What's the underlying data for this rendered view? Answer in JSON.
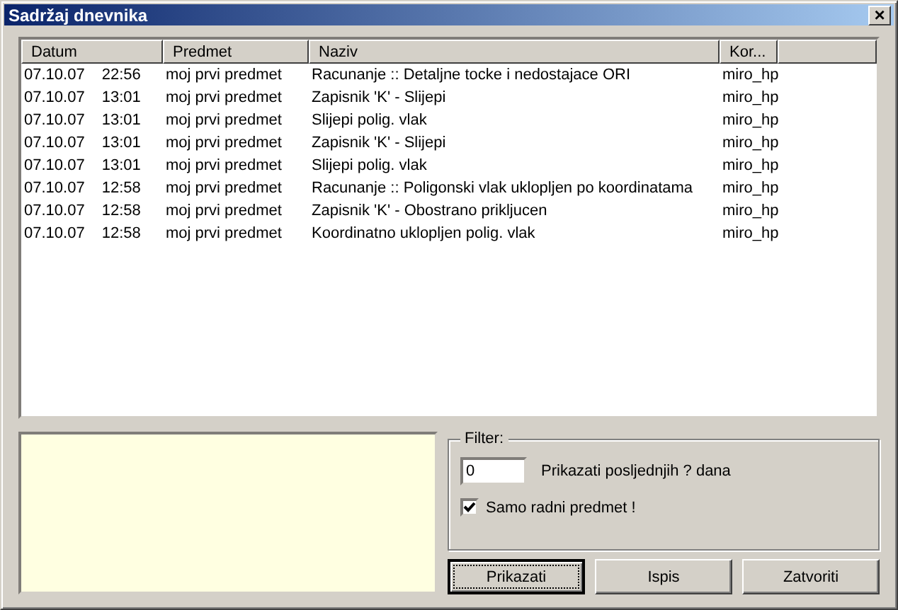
{
  "window": {
    "title": "Sadržaj dnevnika",
    "close": "×"
  },
  "table": {
    "columns": [
      "Datum",
      "Predmet",
      "Naziv",
      "Kor..."
    ],
    "rows": [
      {
        "date": "07.10.07",
        "time": "22:56",
        "predmet": "moj prvi predmet",
        "naziv": "Racunanje :: Detaljne tocke i nedostajace ORI",
        "korisnik": "miro_hp"
      },
      {
        "date": "07.10.07",
        "time": "13:01",
        "predmet": "moj prvi predmet",
        "naziv": "Zapisnik 'K' - Slijepi",
        "korisnik": "miro_hp"
      },
      {
        "date": "07.10.07",
        "time": "13:01",
        "predmet": "moj prvi predmet",
        "naziv": "Slijepi polig. vlak",
        "korisnik": "miro_hp"
      },
      {
        "date": "07.10.07",
        "time": "13:01",
        "predmet": "moj prvi predmet",
        "naziv": "Zapisnik 'K' - Slijepi",
        "korisnik": "miro_hp"
      },
      {
        "date": "07.10.07",
        "time": "13:01",
        "predmet": "moj prvi predmet",
        "naziv": "Slijepi polig. vlak",
        "korisnik": "miro_hp"
      },
      {
        "date": "07.10.07",
        "time": "12:58",
        "predmet": "moj prvi predmet",
        "naziv": "Racunanje :: Poligonski vlak uklopljen po koordinatama",
        "korisnik": "miro_hp"
      },
      {
        "date": "07.10.07",
        "time": "12:58",
        "predmet": "moj prvi predmet",
        "naziv": "Zapisnik 'K' - Obostrano prikljucen",
        "korisnik": "miro_hp"
      },
      {
        "date": "07.10.07",
        "time": "12:58",
        "predmet": "moj prvi predmet",
        "naziv": "Koordinatno uklopljen polig. vlak",
        "korisnik": "miro_hp"
      }
    ]
  },
  "filter": {
    "title": "Filter:",
    "days_value": "0",
    "days_label": "Prikazati posljednjih ? dana",
    "only_current": {
      "label": "Samo radni predmet !",
      "checked": true
    }
  },
  "buttons": [
    {
      "label": "Prikazati",
      "focused": true
    },
    {
      "label": "Ispis",
      "focused": false
    },
    {
      "label": "Zatvoriti",
      "focused": false
    }
  ]
}
